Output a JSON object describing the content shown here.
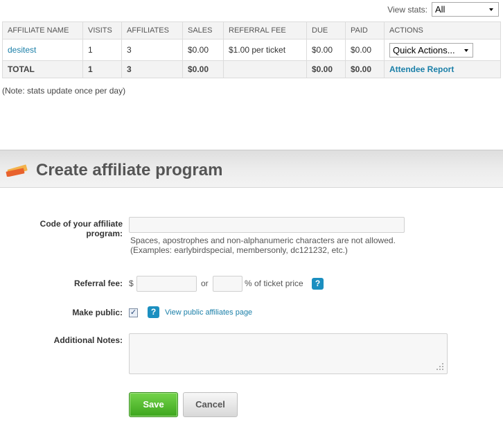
{
  "view_stats": {
    "label": "View stats:",
    "selected": "All"
  },
  "table": {
    "headers": [
      "AFFILIATE NAME",
      "VISITS",
      "AFFILIATES",
      "SALES",
      "REFERRAL FEE",
      "DUE",
      "PAID",
      "ACTIONS"
    ],
    "row": {
      "name": "desitest",
      "visits": "1",
      "affiliates": "3",
      "sales": "$0.00",
      "referral_fee": "$1.00 per ticket",
      "due": "$0.00",
      "paid": "$0.00",
      "action": "Quick Actions..."
    },
    "total": {
      "label": "TOTAL",
      "visits": "1",
      "affiliates": "3",
      "sales": "$0.00",
      "due": "$0.00",
      "paid": "$0.00",
      "report_link": "Attendee Report"
    }
  },
  "note": "(Note: stats update once per day)",
  "section": {
    "title": "Create affiliate program"
  },
  "form": {
    "code_label": "Code of your affiliate program:",
    "code_hint_1": "Spaces, apostrophes and non-alphanumeric characters are not allowed.",
    "code_hint_2": "(Examples: earlybirdspecial, membersonly, dc121232, etc.)",
    "fee_label": "Referral fee:",
    "currency": "$",
    "or": "or",
    "percent_suffix": "% of ticket price",
    "public_label": "Make public:",
    "public_checked": true,
    "public_link": "View public affiliates page",
    "notes_label": "Additional Notes:",
    "save": "Save",
    "cancel": "Cancel",
    "help_glyph": "?"
  }
}
